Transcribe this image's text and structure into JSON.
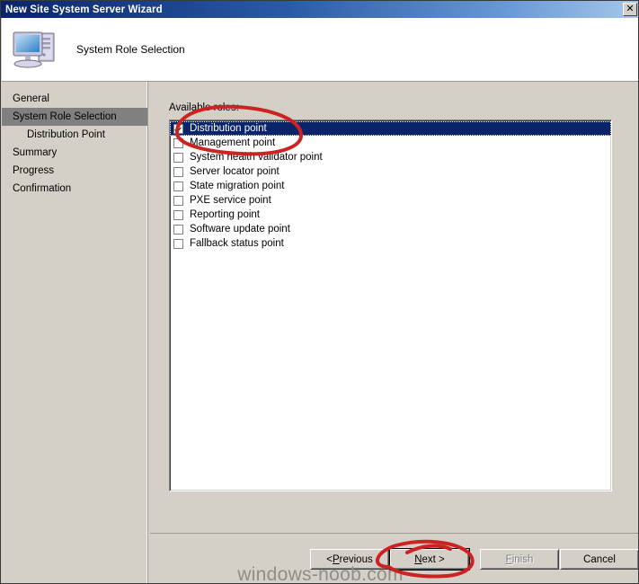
{
  "window": {
    "title": "New Site System Server Wizard",
    "close_label": "✕"
  },
  "header": {
    "title": "System Role Selection",
    "icon": "server-computer-icon"
  },
  "sidebar": {
    "items": [
      {
        "label": "General",
        "selected": false,
        "sub": false
      },
      {
        "label": "System Role Selection",
        "selected": true,
        "sub": false
      },
      {
        "label": "Distribution Point",
        "selected": false,
        "sub": true
      },
      {
        "label": "Summary",
        "selected": false,
        "sub": false
      },
      {
        "label": "Progress",
        "selected": false,
        "sub": false
      },
      {
        "label": "Confirmation",
        "selected": false,
        "sub": false
      }
    ]
  },
  "main": {
    "roles_label": "Available roles:",
    "roles": [
      {
        "label": "Distribution point",
        "checked": true,
        "selected": true
      },
      {
        "label": "Management point",
        "checked": false,
        "selected": false
      },
      {
        "label": "System health validator point",
        "checked": false,
        "selected": false
      },
      {
        "label": "Server locator point",
        "checked": false,
        "selected": false
      },
      {
        "label": "State migration point",
        "checked": false,
        "selected": false
      },
      {
        "label": "PXE service point",
        "checked": false,
        "selected": false
      },
      {
        "label": "Reporting point",
        "checked": false,
        "selected": false
      },
      {
        "label": "Software update point",
        "checked": false,
        "selected": false
      },
      {
        "label": "Fallback status point",
        "checked": false,
        "selected": false
      }
    ]
  },
  "buttons": {
    "previous": {
      "prefix": "< ",
      "accel": "P",
      "rest": "revious",
      "disabled": false
    },
    "next": {
      "prefix": "",
      "accel": "N",
      "rest": "ext >",
      "disabled": false,
      "is_default": true
    },
    "finish": {
      "prefix": "",
      "accel": "F",
      "rest": "inish",
      "disabled": true
    },
    "cancel": {
      "prefix": "",
      "accel": "",
      "rest": "Cancel",
      "disabled": false
    }
  },
  "watermark": {
    "text": "windows-noob.com"
  },
  "colors": {
    "titlebar_start": "#0a246a",
    "titlebar_end": "#a6c8ea",
    "dialog_face": "#d4d0c8",
    "selection": "#0a246a",
    "nav_selected": "#808080",
    "annotation_red": "#cc2222"
  },
  "annotations": [
    {
      "name": "ellipse-around-distribution-point",
      "shape": "ellipse"
    },
    {
      "name": "ellipse-around-next-button",
      "shape": "ellipse"
    }
  ]
}
